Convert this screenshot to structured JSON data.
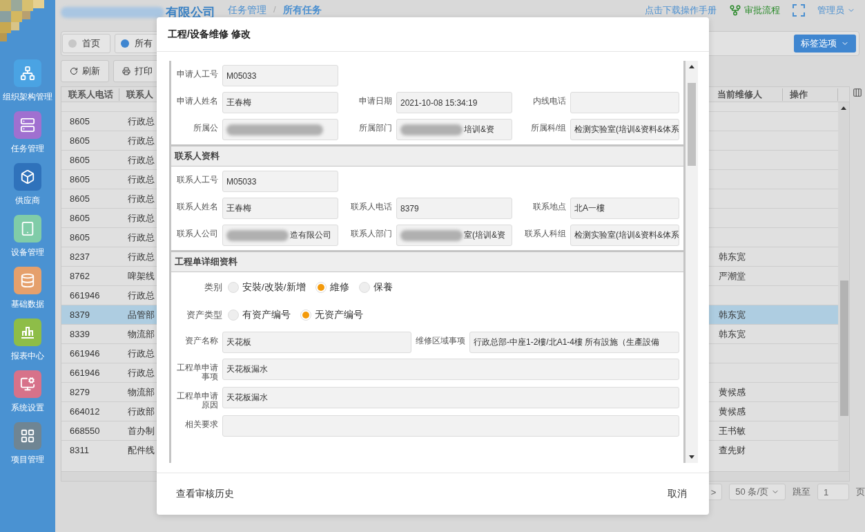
{
  "header": {
    "company": "有限公司",
    "company_redacted": true,
    "breadcrumb": [
      "任务管理",
      "所有任务"
    ],
    "breadcrumb_separator": "/",
    "manual_link": "点击下载操作手册",
    "approval": "审批流程",
    "user": "管理员"
  },
  "sidebar": [
    {
      "kind": "org",
      "label": "组织架构管理",
      "color": "#4aa3e3"
    },
    {
      "kind": "tasks",
      "label": "任务管理",
      "color": "#a070d0"
    },
    {
      "kind": "box",
      "label": "供应商",
      "color": "#2f72bb"
    },
    {
      "kind": "device",
      "label": "设备管理",
      "color": "#80cca8"
    },
    {
      "kind": "database",
      "label": "基础数据",
      "color": "#e5a06c"
    },
    {
      "kind": "chart",
      "label": "报表中心",
      "color": "#8ebd48"
    },
    {
      "kind": "settings",
      "label": "系统设置",
      "color": "#d7728a"
    },
    {
      "kind": "grid",
      "label": "项目管理",
      "color": "#6f8593"
    }
  ],
  "tabs": [
    {
      "label": "首页",
      "selected": false
    },
    {
      "label": "所有",
      "selected": true
    }
  ],
  "tag_button": "标签选项",
  "toolbar": [
    {
      "kind": "refresh",
      "label": "刷新"
    },
    {
      "kind": "print",
      "label": "打印"
    }
  ],
  "table": {
    "columns": [
      "联系人电话",
      "联系人",
      "当前维修人",
      "操作"
    ],
    "rows": [
      {
        "phone": "8605",
        "dept": "行政总",
        "repairer": "",
        "selected": false
      },
      {
        "phone": "8605",
        "dept": "行政总",
        "repairer": "",
        "selected": false
      },
      {
        "phone": "8605",
        "dept": "行政总",
        "repairer": "",
        "selected": false
      },
      {
        "phone": "8605",
        "dept": "行政总",
        "repairer": "",
        "selected": false
      },
      {
        "phone": "8605",
        "dept": "行政总",
        "repairer": "",
        "selected": false
      },
      {
        "phone": "8605",
        "dept": "行政总",
        "repairer": "",
        "selected": false
      },
      {
        "phone": "8605",
        "dept": "行政总",
        "repairer": "",
        "selected": false
      },
      {
        "phone": "8237",
        "dept": "行政总",
        "repairer": "韩东宽",
        "selected": false
      },
      {
        "phone": "8762",
        "dept": "啤架线",
        "repairer": "严潮堂",
        "selected": false
      },
      {
        "phone": "661946",
        "dept": "行政总",
        "repairer": "",
        "selected": false
      },
      {
        "phone": "8379",
        "dept": "品管部",
        "repairer": "韩东宽",
        "selected": true
      },
      {
        "phone": "8339",
        "dept": "物流部",
        "repairer": "韩东宽",
        "selected": false
      },
      {
        "phone": "661946",
        "dept": "行政总",
        "repairer": "",
        "selected": false
      },
      {
        "phone": "661946",
        "dept": "行政总",
        "repairer": "",
        "selected": false
      },
      {
        "phone": "8279",
        "dept": "物流部",
        "repairer": "黄候感",
        "selected": false
      },
      {
        "phone": "664012",
        "dept": "行政部",
        "repairer": "黄候感",
        "selected": false
      },
      {
        "phone": "668550",
        "dept": "首办制",
        "repairer": "王书敏",
        "selected": false
      },
      {
        "phone": "8311",
        "dept": "配件线",
        "repairer": "查先财",
        "selected": false
      }
    ]
  },
  "pagination": {
    "next": ">",
    "page_size": "50 条/页",
    "jump_label": "跳至",
    "page": "1",
    "page_unit": "页"
  },
  "modal": {
    "title": "工程/设备维修 修改",
    "sections": [
      {
        "rows": [
          {
            "kind": "thirds",
            "fields": [
              {
                "label": "申请人工号",
                "value": "M05033"
              }
            ]
          },
          {
            "kind": "thirds",
            "fields": [
              {
                "label": "申请人姓名",
                "value": "王春梅"
              },
              {
                "label": "申请日期",
                "value": "2021-10-08 15:34:19"
              },
              {
                "label": "内线电话"
              }
            ]
          },
          {
            "kind": "thirds",
            "fields": [
              {
                "label": "所属公",
                "redacted": true
              },
              {
                "label": "所属部门",
                "value": "培训&资",
                "redacted": true
              },
              {
                "label": "所属科/组",
                "value": "检测实验室(培训&资料&体系"
              }
            ]
          }
        ]
      },
      {
        "title": "联系人资料",
        "rows": [
          {
            "kind": "thirds",
            "fields": [
              {
                "label": "联系人工号",
                "value": "M05033"
              }
            ]
          },
          {
            "kind": "thirds",
            "fields": [
              {
                "label": "联系人姓名",
                "value": "王春梅"
              },
              {
                "label": "联系人电话",
                "value": "8379"
              },
              {
                "label": "联系地点",
                "value": "北A一樓"
              }
            ]
          },
          {
            "kind": "thirds",
            "fields": [
              {
                "label": "联系人公司",
                "value": "造有限公司",
                "redacted": true
              },
              {
                "label": "联系人部门",
                "value": "室(培训&资",
                "redacted": true
              },
              {
                "label": "联系人科组",
                "value": "检测实验室(培训&资料&体系"
              }
            ]
          }
        ]
      },
      {
        "title": "工程单详细资料",
        "rows": [
          {
            "kind": "radio",
            "label": "类别",
            "options": [
              {
                "label": "安裝/改裝/新增",
                "selected": false
              },
              {
                "label": "維修",
                "selected": true
              },
              {
                "label": "保養",
                "selected": false
              }
            ]
          },
          {
            "kind": "radio",
            "label": "资产类型",
            "options": [
              {
                "label": "有资产编号",
                "selected": false
              },
              {
                "label": "无资产编号",
                "selected": true
              }
            ]
          },
          {
            "kind": "halves",
            "fields": [
              {
                "label": "资产名称",
                "value": "天花板"
              },
              {
                "label": "维修区域事项",
                "value": "行政总部-中座1-2樓/北A1-4樓 所有設施（生產設備"
              }
            ]
          },
          {
            "kind": "full",
            "fields": [
              {
                "label": "工程单申请事项",
                "value": "天花板漏水"
              }
            ]
          },
          {
            "kind": "full",
            "fields": [
              {
                "label": "工程单申请原因",
                "value": "天花板漏水"
              }
            ]
          },
          {
            "kind": "full",
            "fields": [
              {
                "label": "相关要求"
              }
            ]
          }
        ]
      }
    ],
    "history_button": "查看审核历史",
    "cancel_button": "取消"
  }
}
